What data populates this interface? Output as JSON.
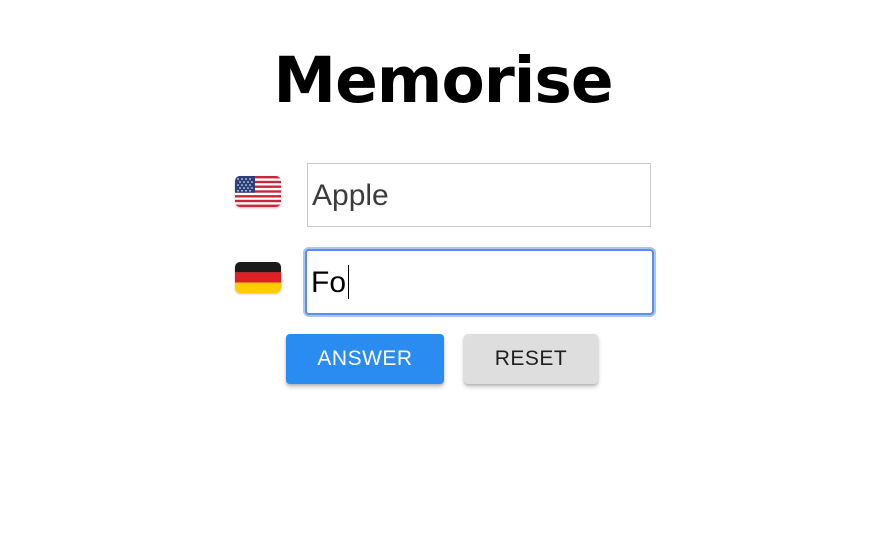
{
  "app": {
    "title": "Memorise"
  },
  "source": {
    "language_icon": "us-flag-icon",
    "value": "Apple"
  },
  "target": {
    "language_icon": "germany-flag-icon",
    "value": "Fo"
  },
  "buttons": {
    "answer_label": "ANSWER",
    "reset_label": "RESET"
  },
  "colors": {
    "answer_button": "#2a8cf0",
    "reset_button": "#dedede",
    "focus_ring": "#5b8def"
  }
}
